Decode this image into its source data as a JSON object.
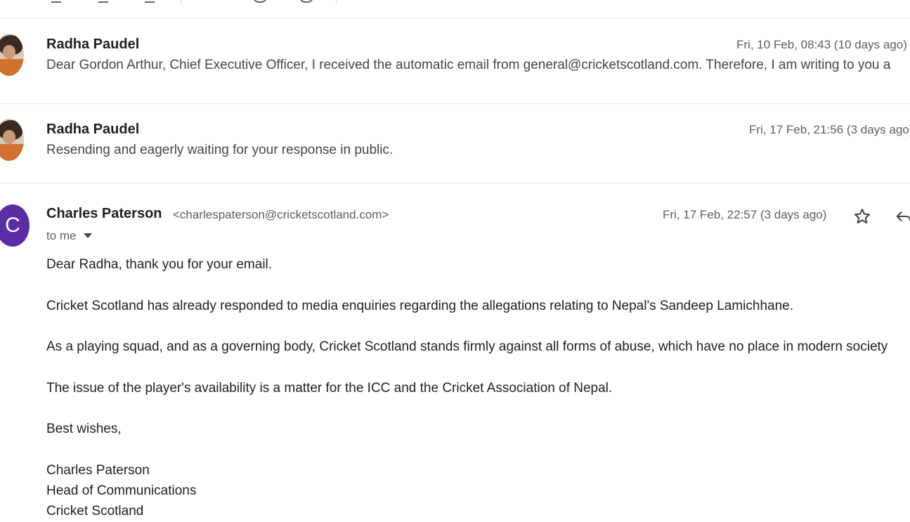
{
  "toolbar": {
    "icons": [
      "archive-icon",
      "report-icon",
      "delete-icon",
      "snooze-icon",
      "task-icon"
    ]
  },
  "messages_collapsed": [
    {
      "sender": "Radha Paudel",
      "date": "Fri, 10 Feb, 08:43 (10 days ago)",
      "snippet": "Dear Gordon Arthur, Chief Executive Officer, I received the automatic email from general@cricketscotland.com. Therefore, I am writing to you a"
    },
    {
      "sender": "Radha Paudel",
      "date": "Fri, 17 Feb, 21:56 (3 days ago)",
      "snippet": "Resending and eagerly waiting for your response in public."
    }
  ],
  "message_open": {
    "avatar_letter": "C",
    "avatar_color": "#5a2ca6",
    "sender_name": "Charles Paterson",
    "sender_email": "<charlespaterson@cricketscotland.com>",
    "date": "Fri, 17 Feb, 22:57 (3 days ago)",
    "to_label": "to me",
    "body": [
      "Dear Radha, thank you for your email.",
      "Cricket Scotland has already responded to media enquiries regarding the allegations relating to Nepal's Sandeep Lamichhane.",
      "As a playing squad, and as a governing body, Cricket Scotland stands firmly against all forms of abuse, which have no place in modern society",
      "The issue of the player's availability is a matter for the ICC and the Cricket Association of Nepal.",
      "Best wishes,",
      "Charles Paterson",
      "Head of Communications",
      "Cricket Scotland"
    ]
  }
}
